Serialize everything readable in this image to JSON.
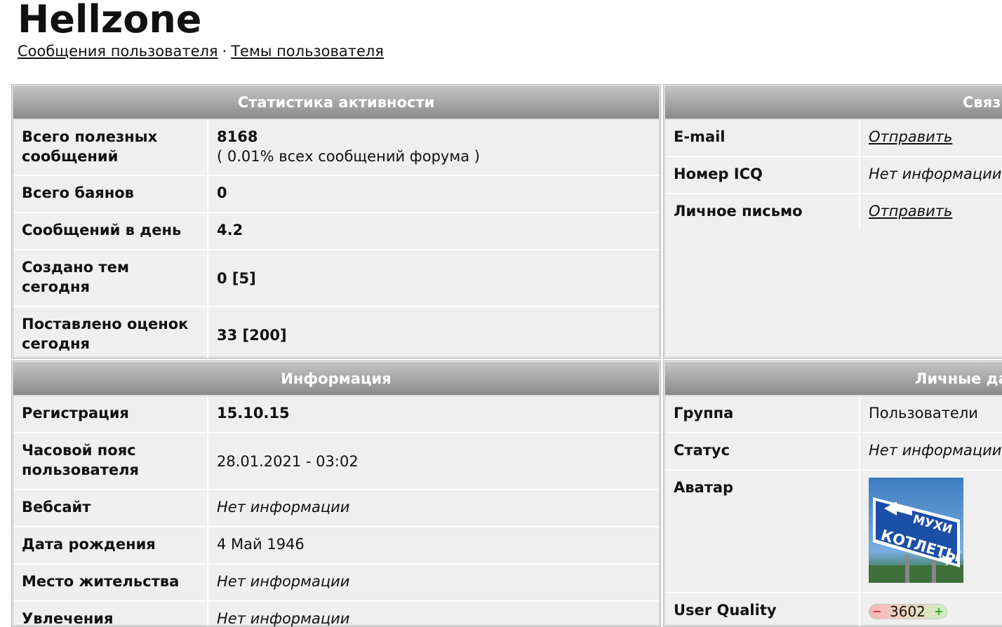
{
  "header": {
    "username": "Hellzone",
    "links": {
      "posts": "Сообщения пользователя",
      "sep": "·",
      "topics": "Темы пользователя"
    }
  },
  "activity": {
    "title": "Статистика активности",
    "rows": [
      {
        "label": "Всего полезных сообщений",
        "value": "8168",
        "sub": "( 0.01% всех сообщений форума )"
      },
      {
        "label": "Всего баянов",
        "value": "0"
      },
      {
        "label": "Сообщений в день",
        "value": "4.2"
      },
      {
        "label": "Создано тем сегодня",
        "value": "0 [5]"
      },
      {
        "label": "Поставлено оценок сегодня",
        "value": "33 [200]"
      }
    ]
  },
  "contacts": {
    "title": "Связь",
    "rows": [
      {
        "label": "E-mail",
        "value": "Отправить"
      },
      {
        "label": "Номер ICQ",
        "value": "Нет информации"
      },
      {
        "label": "Личное письмо",
        "value": "Отправить"
      }
    ]
  },
  "info": {
    "title": "Информация",
    "rows": [
      {
        "label": "Регистрация",
        "value": "15.10.15"
      },
      {
        "label": "Часовой пояс пользователя",
        "value": "28.01.2021 - 03:02"
      },
      {
        "label": "Вебсайт",
        "value": "Нет информации"
      },
      {
        "label": "Дата рождения",
        "value": "4 Май 1946"
      },
      {
        "label": "Место жительства",
        "value": "Нет информации"
      },
      {
        "label": "Увлечения",
        "value": "Нет информации"
      }
    ]
  },
  "personal": {
    "title": "Личные данные",
    "rows": [
      {
        "label": "Группа",
        "value": "Пользователи"
      },
      {
        "label": "Статус",
        "value": "Нет информации"
      },
      {
        "label": "Аватар",
        "sign_line1": "МУХИ",
        "sign_line2": "КОТЛЕТЫ"
      },
      {
        "label": "User Quality",
        "minus": "−",
        "value": "3602",
        "plus": "+"
      }
    ]
  },
  "colors": {
    "header_top": "#c4c4c4",
    "header_bottom": "#8a8a8a",
    "panel_bg": "#efefef"
  }
}
